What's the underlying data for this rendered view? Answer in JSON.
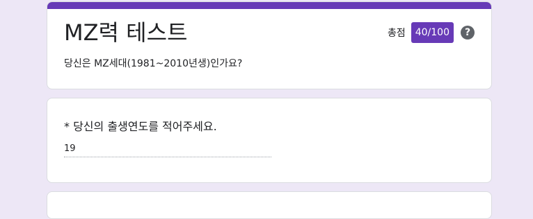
{
  "header": {
    "title": "MZ력 테스트",
    "score_label": "총점",
    "score_value": "40/100",
    "help_icon": "?",
    "description": "당신은 MZ세대(1981~2010년생)인가요?"
  },
  "question": {
    "text": "* 당신의 출생연도를 적어주세요.",
    "answer_value": "19"
  },
  "colors": {
    "accent": "#673ab7",
    "background": "#ede7f6"
  }
}
